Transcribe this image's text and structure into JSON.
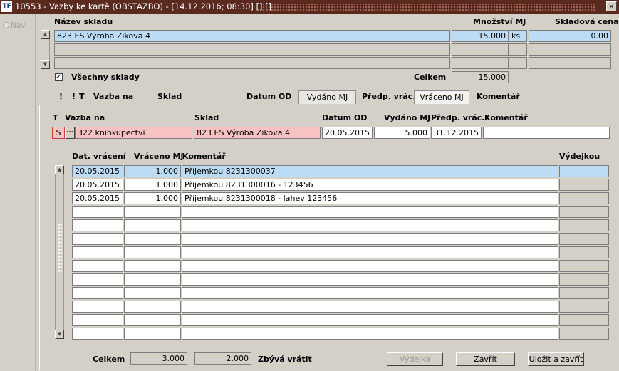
{
  "window": {
    "title": "10553 - Vazby ke kartě (OBSTAZBO) - [14.12.2016; 08:30] [] []",
    "close": "×",
    "logo": "TF"
  },
  "nav": {
    "label": "Nav"
  },
  "top": {
    "h_nazev": "Název skladu",
    "h_mnozstvi": "Množství MJ",
    "h_cena": "Skladová cena",
    "row": {
      "sklad": "823 ES Výroba Zikova 4",
      "mnozstvi": "15.000",
      "mj": "ks",
      "cena": "0.00"
    },
    "vsechny": "Všechny sklady",
    "celkem_label": "Celkem",
    "celkem": "15.000"
  },
  "tabsbar": {
    "excl1": "!",
    "excl2": "!",
    "t": "T",
    "vazba": "Vazba na",
    "sklad": "Sklad",
    "datum": "Datum OD",
    "tab_vydano": "Vydáno MJ",
    "predp": "Předp. vrác.",
    "tab_vraceno": "Vráceno MJ",
    "komentar": "Komentář"
  },
  "detail": {
    "h_t": "T",
    "h_vazba": "Vazba na",
    "h_sklad": "Sklad",
    "h_datum": "Datum OD",
    "h_vydano": "Vydáno MJ",
    "h_predp": "Předp. vrác.",
    "h_koment": "Komentář",
    "t": "S",
    "dots": "...",
    "vazba": "322 knihkupectví",
    "sklad": "823 ES Výroba Zikova 4",
    "datum": "20.05.2015",
    "vydano": "5.000",
    "predp": "31.12.2015",
    "koment": ""
  },
  "grid": {
    "h_dat": "Dat. vrácení",
    "h_vraceno": "Vráceno MJ",
    "h_koment": "Komentář",
    "h_vydejkou": "Výdejkou",
    "rows": [
      {
        "dat": "20.05.2015",
        "vraceno": "1.000",
        "koment": "Příjemkou 8231300037"
      },
      {
        "dat": "20.05.2015",
        "vraceno": "1.000",
        "koment": "Příjemkou 8231300016 - 123456"
      },
      {
        "dat": "20.05.2015",
        "vraceno": "1.000",
        "koment": "Příjemkou 8231300018 - lahev 123456"
      }
    ]
  },
  "footer": {
    "celkem_label": "Celkem",
    "celkem1": "3.000",
    "celkem2": "2.000",
    "zbyva": "Zbývá vrátit",
    "btn_vydejka": "Výdejka",
    "btn_zavrit": "Zavřít",
    "btn_ulozit": "Uložit a zavřít"
  }
}
